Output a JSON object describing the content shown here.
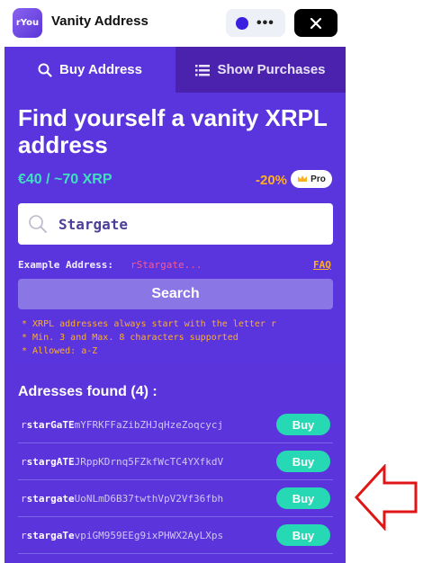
{
  "header": {
    "logo_text": "rYou",
    "title": "Vanity Address",
    "more_label": "•••"
  },
  "tabs": [
    {
      "label": "Buy Address",
      "icon": "search-icon"
    },
    {
      "label": "Show Purchases",
      "icon": "list-icon"
    }
  ],
  "hero": {
    "title": "Find yourself a vanity XRPL address",
    "price": "€40 / ~70 XRP",
    "discount": "-20%",
    "pro_label": "Pro"
  },
  "search": {
    "value": "Stargate",
    "example_label": "Example Address:",
    "example_value": "rStargate...",
    "faq_label": "FAQ",
    "button_label": "Search"
  },
  "hints": [
    "* XRPL addresses always start with the letter r",
    "* Min. 3 and Max. 8 characters supported",
    "* Allowed: a-Z"
  ],
  "results": {
    "title": "Adresses found (4) :",
    "items": [
      {
        "prefix": "r",
        "match": "starGaTE",
        "rest": "mYFRKFFaZibZHJqHzeZoqcycj",
        "buy_label": "Buy"
      },
      {
        "prefix": "r",
        "match": "stargATE",
        "rest": "JRppKDrnq5FZkfWcTC4YXfkdV",
        "buy_label": "Buy"
      },
      {
        "prefix": "r",
        "match": "stargate",
        "rest": "UoNLmD6B37twthVpV2Vf36fbh",
        "buy_label": "Buy"
      },
      {
        "prefix": "r",
        "match": "stargaTe",
        "rest": "vpiGM959EEg9ixPHWX2AyLXps",
        "buy_label": "Buy"
      }
    ]
  },
  "colors": {
    "panel": "#5a34dc",
    "accent_teal": "#27d8b4",
    "accent_orange": "#ffb020",
    "annotation_red": "#e01515"
  }
}
